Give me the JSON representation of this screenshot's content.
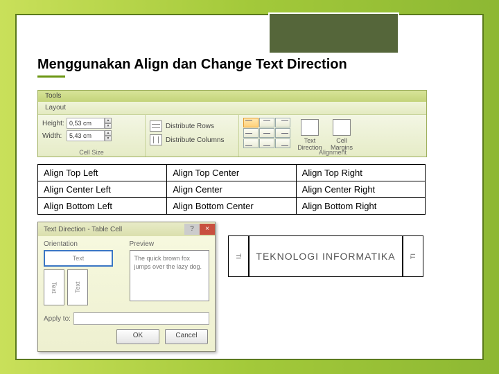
{
  "title": "Menggunakan Align dan Change Text Direction",
  "ribbon": {
    "tab_group": "Tools",
    "tab": "Layout",
    "height_label": "Height:",
    "height_value": "0,53 cm",
    "width_label": "Width:",
    "width_value": "5,43 cm",
    "cellsize_label": "Cell Size",
    "dist_rows": "Distribute Rows",
    "dist_cols": "Distribute Columns",
    "text_direction": "Text Direction",
    "cell_margins": "Cell Margins",
    "alignment_label": "Alignment"
  },
  "align_table": {
    "rows": [
      [
        "Align Top Left",
        "Align Top Center",
        "Align Top Right"
      ],
      [
        "Align Center Left",
        "Align Center",
        "Align Center Right"
      ],
      [
        "Align Bottom Left",
        "Align Bottom Center",
        "Align Bottom Right"
      ]
    ]
  },
  "dialog": {
    "title": "Text Direction - Table Cell",
    "orientation_label": "Orientation",
    "preview_label": "Preview",
    "sample_h": "Text",
    "sample_v1": "Text",
    "sample_v2": "Text",
    "preview_text": "The quick brown fox jumps over the lazy dog.",
    "apply_label": "Apply to:",
    "ok": "OK",
    "cancel": "Cancel"
  },
  "examples": {
    "vert1": "TI",
    "horiz": "TEKNOLOGI INFORMATIKA",
    "vert2": "TI"
  }
}
